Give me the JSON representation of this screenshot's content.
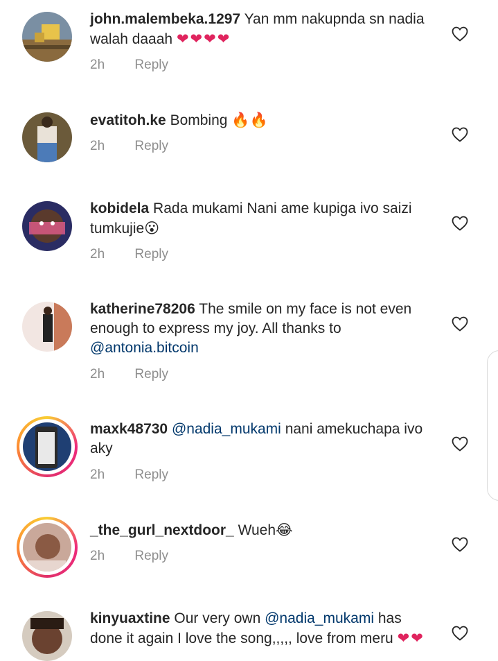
{
  "comments": [
    {
      "user": "john.malembeka.1297",
      "text": "Yan mm nakupnda sn nadia walah daaah",
      "emoji": "❤❤❤❤",
      "time": "2h",
      "reply": "Reply"
    },
    {
      "user": "evatitoh.ke",
      "text": "Bombing",
      "emoji": "🔥🔥",
      "time": "2h",
      "reply": "Reply"
    },
    {
      "user": "kobidela",
      "text": "Rada mukami Nani ame kupiga ivo saizi tumkujie",
      "emoji": "😮",
      "time": "2h",
      "reply": "Reply"
    },
    {
      "user": "katherine78206",
      "text": "The smile on my face is not even enough to express my joy. All thanks to",
      "mention": "@antonia.bitcoin",
      "time": "2h",
      "reply": "Reply"
    },
    {
      "user": "maxk48730",
      "mention": "@nadia_mukami",
      "text": "nani amekuchapa ivo aky",
      "time": "2h",
      "reply": "Reply"
    },
    {
      "user": "_the_gurl_nextdoor_",
      "text": "Wueh",
      "emoji": "😂",
      "time": "2h",
      "reply": "Reply"
    },
    {
      "user": "kinyuaxtine",
      "text_before": "Our very own",
      "mention": "@nadia_mukami",
      "text": "has done it again I love the song,,,,, love from meru",
      "emoji": "❤❤"
    }
  ],
  "colors": {
    "mention": "#00376b",
    "meta": "#8e8e8e",
    "heart_outline": "#262626",
    "ring": "#e1306c"
  },
  "icons": {
    "like": "heart-outline-icon"
  }
}
